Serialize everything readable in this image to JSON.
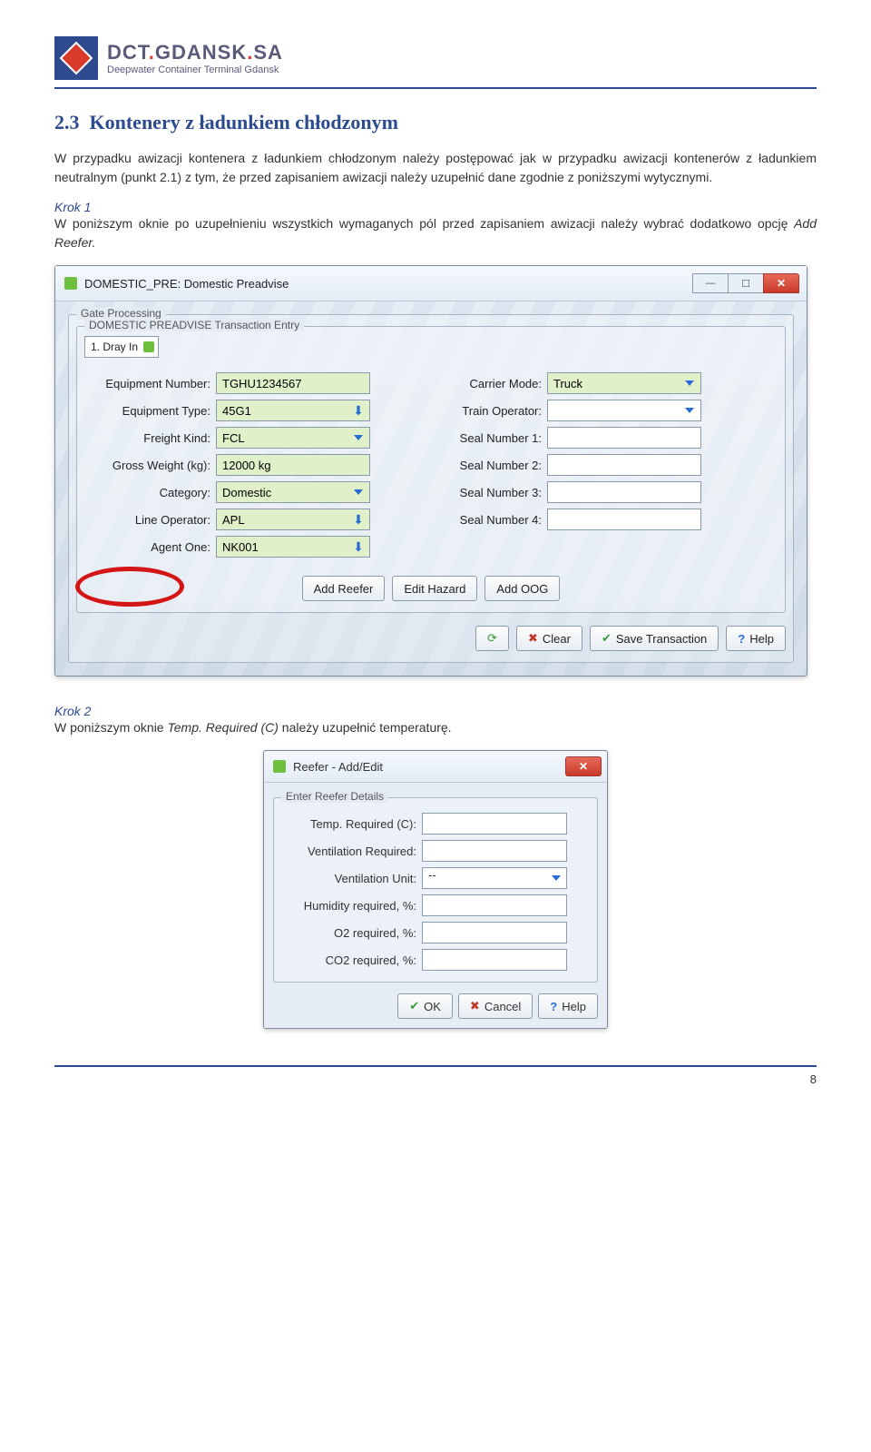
{
  "brand": {
    "name_part1": "DCT",
    "name_part2": "GDANSK",
    "name_part3": "SA",
    "tagline": "Deepwater Container Terminal Gdansk"
  },
  "section": {
    "number": "2.3",
    "title": "Kontenery z ładunkiem chłodzonym",
    "para1": "W przypadku awizacji kontenera z ładunkiem chłodzonym należy postępować jak w przypadku awizacji kontenerów z ładunkiem neutralnym (punkt 2.1) z tym, że przed zapisaniem awizacji należy uzupełnić dane zgodnie z poniższymi wytycznymi.",
    "krok1_label": "Krok 1",
    "krok1_text_a": "W poniższym oknie po uzupełnieniu wszystkich wymaganych pól przed zapisaniem awizacji należy wybrać dodatkowo opcję ",
    "krok1_text_b": "Add Reefer.",
    "krok2_label": "Krok 2",
    "krok2_text_a": "W poniższym oknie ",
    "krok2_text_b": "Temp. Required (C)",
    "krok2_text_c": " należy uzupełnić temperaturę."
  },
  "win1": {
    "title": "DOMESTIC_PRE: Domestic Preadvise",
    "group_gate": "Gate Processing",
    "group_trans": "DOMESTIC PREADVISE Transaction Entry",
    "dray_in": "1. Dray In",
    "labels": {
      "equip_no": "Equipment Number:",
      "equip_type": "Equipment Type:",
      "freight": "Freight Kind:",
      "gross": "Gross Weight (kg):",
      "category": "Category:",
      "line_op": "Line Operator:",
      "agent": "Agent One:",
      "carrier": "Carrier Mode:",
      "train": "Train Operator:",
      "seal1": "Seal Number 1:",
      "seal2": "Seal Number 2:",
      "seal3": "Seal Number 3:",
      "seal4": "Seal Number 4:"
    },
    "values": {
      "equip_no": "TGHU1234567",
      "equip_type": "45G1",
      "freight": "FCL",
      "gross": "12000 kg",
      "category": "Domestic",
      "line_op": "APL",
      "agent": "NK001",
      "carrier": "Truck",
      "train": "",
      "seal1": "",
      "seal2": "",
      "seal3": "",
      "seal4": ""
    },
    "buttons": {
      "add_reefer": "Add Reefer",
      "edit_hazard": "Edit Hazard",
      "add_oog": "Add OOG",
      "clear": "Clear",
      "save": "Save Transaction",
      "help": "Help"
    }
  },
  "win2": {
    "title": "Reefer - Add/Edit",
    "group": "Enter Reefer Details",
    "labels": {
      "temp": "Temp. Required (C):",
      "vent_req": "Ventilation Required:",
      "vent_unit": "Ventilation Unit:",
      "humidity": "Humidity required, %:",
      "o2": "O2 required, %:",
      "co2": "CO2 required, %:"
    },
    "values": {
      "vent_unit": "--"
    },
    "buttons": {
      "ok": "OK",
      "cancel": "Cancel",
      "help": "Help"
    }
  },
  "page_number": "8"
}
